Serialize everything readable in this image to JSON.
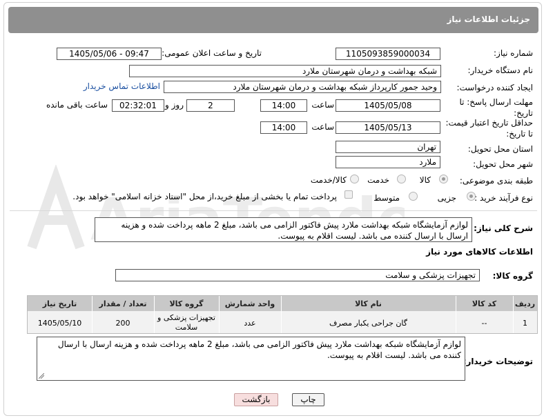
{
  "header": {
    "title": "جزئیات اطلاعات نیاز"
  },
  "need_number": {
    "label": "شماره نیاز:",
    "value": "1105093859000034"
  },
  "announce_datetime": {
    "label": "تاریخ و ساعت اعلان عمومی:",
    "value": "1405/05/06 - 09:47"
  },
  "buyer_org": {
    "label": "نام دستگاه خریدار:",
    "value": "شبکه بهداشت و درمان شهرستان ملارد"
  },
  "requester": {
    "label": "ایجاد کننده درخواست:",
    "value": "وحید جمور کارپرداز شبکه بهداشت و درمان شهرستان ملارد",
    "contact_link": "اطلاعات تماس خریدار"
  },
  "reply_deadline": {
    "label": "مهلت ارسال پاسخ: تا تاریخ:",
    "date": "1405/05/08",
    "time_label": "ساعت",
    "time": "14:00",
    "days": "2",
    "days_label": "روز و",
    "remaining": "02:32:01",
    "remaining_label": "ساعت باقی مانده"
  },
  "price_validity": {
    "label": "حداقل تاریخ اعتبار قیمت: تا تاریخ:",
    "date": "1405/05/13",
    "time_label": "ساعت",
    "time": "14:00"
  },
  "province": {
    "label": "استان محل تحویل:",
    "value": "تهران"
  },
  "city": {
    "label": "شهر محل تحویل:",
    "value": "ملارد"
  },
  "category": {
    "label": "طبقه بندی موضوعی:",
    "options": [
      "کالا",
      "خدمت",
      "کالا/خدمت"
    ],
    "selected": 0
  },
  "purchase_type": {
    "label": "نوع فرآیند خرید :",
    "options": [
      "جزیی",
      "متوسط"
    ],
    "selected": 0,
    "treasury_note": "پرداخت تمام یا بخشی از مبلغ خرید،از محل \"اسناد خزانه اسلامی\" خواهد بود."
  },
  "description": {
    "label": "شرح کلی نیاز:",
    "value": "لوازم آزمایشگاه شبکه بهداشت ملارد پیش فاکتور الزامی می باشد، مبلغ 2 ماهه پرداخت شده و هزینه ارسال با ارسال کننده می باشد. لیست اقلام به پیوست."
  },
  "goods_info": {
    "title": "اطلاعات کالاهای مورد نیاز"
  },
  "goods_group": {
    "label": "گروه کالا:",
    "value": "تجهیزات پزشکی و سلامت"
  },
  "table": {
    "headers": [
      "ردیف",
      "کد کالا",
      "نام کالا",
      "واحد شمارش",
      "گروه کالا",
      "تعداد / مقدار",
      "تاریخ نیاز"
    ],
    "rows": [
      [
        "1",
        "--",
        "گان جراحی یکبار مصرف",
        "عدد",
        "تجهیزات پزشکی و سلامت",
        "200",
        "1405/05/10"
      ]
    ]
  },
  "buyer_notes": {
    "label": "توضیحات خریدار:",
    "value": "لوازم آزمایشگاه شبکه بهداشت ملارد پیش فاکتور الزامی می باشد، مبلغ 2 ماهه پرداخت شده و هزینه ارسال با ارسال کننده می باشد. لیست اقلام به پیوست."
  },
  "buttons": {
    "print": "چاپ",
    "back": "بازگشت"
  },
  "watermark": {
    "text": "AriaTender.net"
  },
  "colors": {
    "header_bg": "#8f8f8f",
    "link": "#1a4fa0",
    "back_btn_bg": "#f7dede",
    "watermark": "#e6e6e6"
  }
}
